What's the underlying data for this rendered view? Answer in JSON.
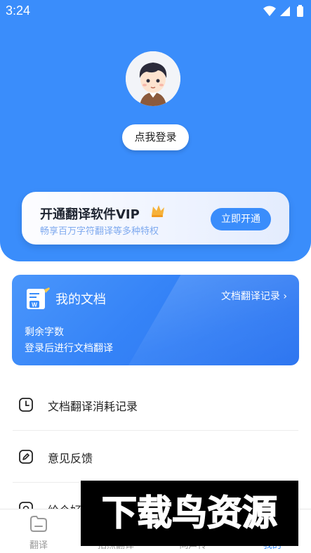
{
  "status_bar": {
    "time": "3:24"
  },
  "profile": {
    "login_label": "点我登录"
  },
  "vip": {
    "title": "开通翻译软件VIP",
    "subtitle": "畅享百万字符翻译等多种特权",
    "button_label": "立即开通",
    "accent_color": "#3a8dfb"
  },
  "doc_card": {
    "title": "我的文档",
    "records_link": "文档翻译记录",
    "remaining_label": "剩余字数",
    "hint": "登录后进行文档翻译"
  },
  "menu": {
    "items": [
      {
        "label": "文档翻译消耗记录",
        "icon": "clock-icon"
      },
      {
        "label": "意见反馈",
        "icon": "edit-icon"
      },
      {
        "label": "给个好评",
        "icon": "star-icon"
      }
    ]
  },
  "bottom_nav": {
    "items": [
      {
        "label": "翻译",
        "icon": "translate-icon"
      },
      {
        "label": "拍照翻译",
        "icon": "camera-icon"
      },
      {
        "label": "同声传",
        "icon": "mic-icon"
      },
      {
        "label": "我的",
        "icon": "profile-icon"
      }
    ],
    "active_index": 3
  },
  "watermark": {
    "text": "下载鸟资源"
  }
}
